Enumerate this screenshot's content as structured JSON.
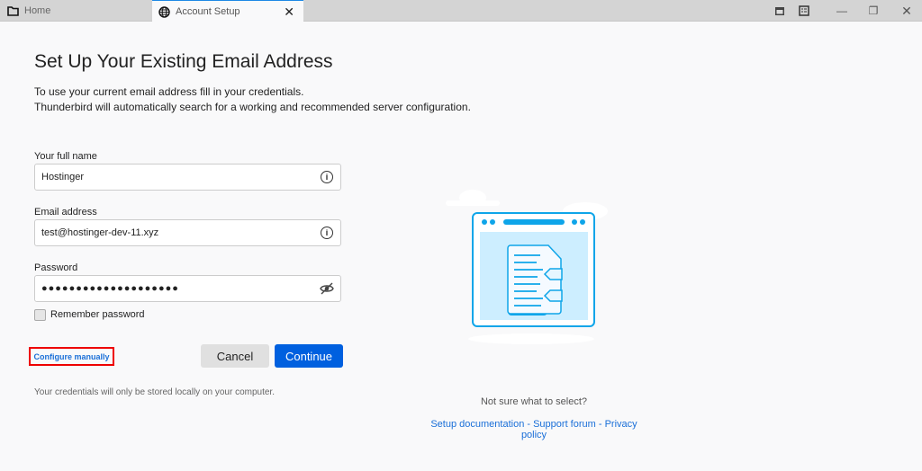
{
  "tabs": [
    {
      "label": "Home",
      "icon": "folder-icon"
    },
    {
      "label": "Account Setup",
      "icon": "globe-icon",
      "active": true
    }
  ],
  "window_controls": [
    "calendar-icon",
    "tasks-icon",
    "minimize-icon",
    "restore-icon",
    "close-icon"
  ],
  "title": "Set Up Your Existing Email Address",
  "intro": [
    "To use your current email address fill in your credentials.",
    "Thunderbird will automatically search for a working and recommended server configuration."
  ],
  "form": {
    "name_label": "Your full name",
    "name_value": "Hostinger",
    "email_label": "Email address",
    "email_value": "test@hostinger-dev-11.xyz",
    "password_label": "Password",
    "password_value": "●●●●●●●●●●●●●●●●●●●●",
    "remember_label": "Remember password",
    "remember_checked": false
  },
  "configure_manually": "Configure manually",
  "cancel": "Cancel",
  "continue": "Continue",
  "note": "Your credentials will only be stored locally on your computer.",
  "help": {
    "question": "Not sure what to select?",
    "links": [
      "Setup documentation",
      "Support forum",
      "Privacy policy"
    ],
    "separator": " - "
  },
  "colors": {
    "accent": "#0060df",
    "link": "#1a6fd8",
    "highlight": "#e00000",
    "illustration": "#0ea5e9"
  }
}
